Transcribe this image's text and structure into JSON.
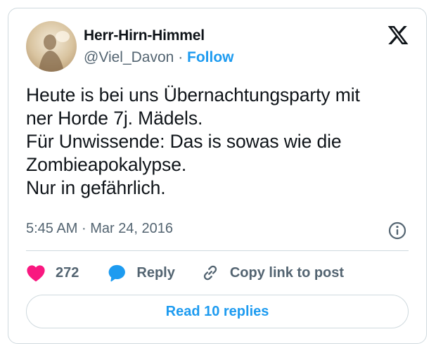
{
  "author": {
    "display_name": "Herr-Hirn-Himmel",
    "handle": "@Viel_Davon",
    "separator": "·",
    "follow_label": "Follow",
    "avatar_icon": "profile-photo"
  },
  "brand": {
    "logo_icon": "x-logo",
    "accent_color": "#1d9bf0",
    "like_color": "#f91880"
  },
  "tweet": {
    "lines": [
      "Heute is bei uns Übernachtungsparty mit",
      "ner Horde 7j. Mädels.",
      "Für Unwissende: Das is sowas wie die",
      "Zombieapokalypse.",
      "Nur in gefährlich."
    ],
    "time": "5:45 AM",
    "separator": "·",
    "date": "Mar 24, 2016",
    "info_icon": "info-icon"
  },
  "actions": {
    "like_icon": "heart-icon",
    "like_count": "272",
    "reply_icon": "speech-bubble-icon",
    "reply_label": "Reply",
    "copy_icon": "link-icon",
    "copy_label": "Copy link to post"
  },
  "footer": {
    "read_replies_label": "Read 10 replies"
  }
}
